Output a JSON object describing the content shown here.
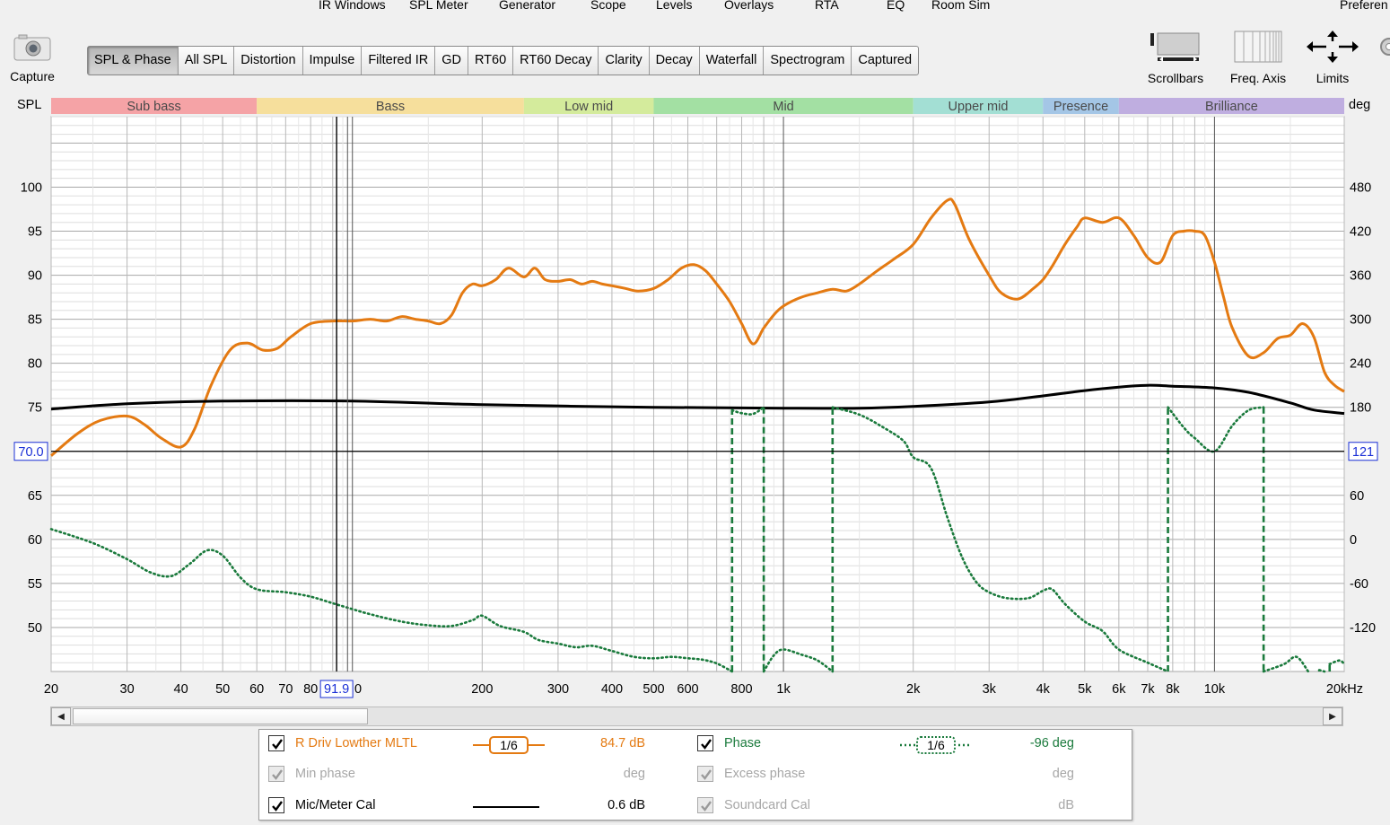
{
  "menu": [
    "IR Windows",
    "SPL Meter",
    "Generator",
    "Scope",
    "Levels",
    "Overlays",
    "RTA",
    "EQ",
    "Room Sim",
    "Preferen"
  ],
  "capture": {
    "label": "Capture"
  },
  "tabs": [
    "SPL & Phase",
    "All SPL",
    "Distortion",
    "Impulse",
    "Filtered IR",
    "GD",
    "RT60",
    "RT60 Decay",
    "Clarity",
    "Decay",
    "Waterfall",
    "Spectrogram",
    "Captured"
  ],
  "active_tab": "SPL & Phase",
  "toolbar_right": {
    "scrollbars": "Scrollbars",
    "freq_axis": "Freq. Axis",
    "limits": "Limits",
    "co": "Co"
  },
  "legend": {
    "rows": [
      {
        "name": "R Driv Lowther MLTL",
        "checked": true,
        "color": "#e47a12",
        "smoothing": "1/6",
        "value": "84.7 dB"
      },
      {
        "name": "Phase",
        "checked": true,
        "color": "#1a7a3c",
        "smoothing": "1/6",
        "value": "-96 deg"
      },
      {
        "name": "Min phase",
        "checked": true,
        "disabled": true,
        "value": "deg"
      },
      {
        "name": "Excess phase",
        "checked": true,
        "disabled": true,
        "value": "deg"
      },
      {
        "name": "Mic/Meter Cal",
        "checked": true,
        "color": "#000000",
        "value": "0.6 dB"
      },
      {
        "name": "Soundcard Cal",
        "checked": true,
        "disabled": true,
        "value": "dB"
      }
    ]
  },
  "chart_data": {
    "type": "line",
    "x_scale": "log",
    "xlim": [
      20,
      20000
    ],
    "ylim": [
      45,
      108
    ],
    "y2lim": [
      -180,
      576
    ],
    "ylabel": "SPL",
    "y2label": "deg",
    "grid": true,
    "y_ticks": [
      100,
      95,
      90,
      85,
      80,
      75,
      70.0,
      65,
      60,
      55,
      50
    ],
    "y2_ticks": [
      480,
      420,
      360,
      300,
      240,
      180,
      121,
      60,
      0,
      -60,
      -120
    ],
    "x_ticks": [
      "20",
      "30",
      "40",
      "50",
      "60",
      "70",
      "80",
      "91.9",
      "0",
      "200",
      "300",
      "400",
      "500",
      "600",
      "800",
      "1k",
      "2k",
      "3k",
      "4k",
      "5k",
      "6k",
      "7k",
      "8k",
      "10k",
      "20kHz"
    ],
    "x_tick_values": [
      20,
      30,
      40,
      50,
      60,
      70,
      80,
      91.9,
      100,
      200,
      300,
      400,
      500,
      600,
      800,
      1000,
      2000,
      3000,
      4000,
      5000,
      6000,
      7000,
      8000,
      10000,
      20000
    ],
    "cursor": {
      "x": 91.9,
      "x_label": "91.9",
      "y": 70.0,
      "y_label": "70.0",
      "y2_label": "121"
    },
    "bands": [
      {
        "name": "Sub bass",
        "from": 20,
        "to": 60,
        "color": "#f5a3a6"
      },
      {
        "name": "Bass",
        "from": 60,
        "to": 250,
        "color": "#f6df9c"
      },
      {
        "name": "Low mid",
        "from": 250,
        "to": 500,
        "color": "#d4eb9c"
      },
      {
        "name": "Mid",
        "from": 500,
        "to": 2000,
        "color": "#a3e0a3"
      },
      {
        "name": "Upper mid",
        "from": 2000,
        "to": 4000,
        "color": "#a3dfd4"
      },
      {
        "name": "Presence",
        "from": 4000,
        "to": 6000,
        "color": "#a4c6e6"
      },
      {
        "name": "Brilliance",
        "from": 6000,
        "to": 20000,
        "color": "#bfaee0"
      }
    ],
    "series": [
      {
        "name": "R Driv Lowther MLTL",
        "axis": "left",
        "style": "solid",
        "color": "#e47a12",
        "x": [
          20,
          23,
          26,
          30,
          33,
          36,
          40,
          43,
          47,
          52,
          57,
          62,
          67,
          72,
          80,
          90,
          100,
          110,
          120,
          130,
          140,
          150,
          160,
          170,
          180,
          190,
          200,
          215,
          230,
          250,
          265,
          280,
          300,
          320,
          340,
          360,
          380,
          400,
          430,
          460,
          500,
          540,
          580,
          620,
          660,
          700,
          750,
          800,
          850,
          900,
          950,
          1000,
          1100,
          1200,
          1300,
          1400,
          1500,
          1650,
          1800,
          2000,
          2200,
          2400,
          2500,
          2700,
          3000,
          3200,
          3500,
          3800,
          4000,
          4200,
          4500,
          4800,
          5000,
          5500,
          6000,
          6500,
          7000,
          7500,
          8000,
          8500,
          9000,
          9500,
          10000,
          10500,
          11000,
          12000,
          13000,
          14000,
          15000,
          16000,
          17000,
          18000,
          19000,
          20000
        ],
        "y": [
          69.5,
          72,
          73.5,
          74,
          73,
          71.5,
          70.5,
          72.5,
          77.5,
          81.5,
          82.3,
          81.5,
          81.7,
          83,
          84.5,
          84.8,
          84.8,
          85,
          84.8,
          85.3,
          85,
          84.8,
          84.5,
          85.5,
          88,
          89,
          88.8,
          89.5,
          90.8,
          89.8,
          90.8,
          89.5,
          89.3,
          89.5,
          89,
          89.3,
          89,
          88.8,
          88.5,
          88.2,
          88.5,
          89.5,
          90.8,
          91.2,
          90.5,
          89,
          87,
          84.5,
          82.2,
          84,
          85.5,
          86.5,
          87.5,
          88,
          88.4,
          88.2,
          89,
          90.5,
          91.8,
          93.5,
          96.5,
          98.5,
          98,
          94,
          90,
          88,
          87.3,
          88.5,
          89.5,
          91,
          93.5,
          95.5,
          96.5,
          96,
          96.5,
          94.5,
          92,
          91.5,
          94.5,
          95,
          95,
          94.5,
          91.5,
          87.5,
          84,
          80.8,
          81.2,
          82.8,
          83.2,
          84.5,
          83,
          79,
          77.5,
          76.8
        ]
      },
      {
        "name": "Mic/Meter Cal",
        "axis": "left",
        "style": "solid",
        "color": "#000000",
        "x": [
          20,
          30,
          50,
          100,
          200,
          500,
          1000,
          1500,
          2000,
          3000,
          4000,
          5000,
          6000,
          7000,
          8000,
          10000,
          12000,
          15000,
          17000,
          20000
        ],
        "y": [
          74.8,
          75.4,
          75.7,
          75.7,
          75.3,
          75.0,
          74.9,
          74.9,
          75.1,
          75.6,
          76.3,
          76.9,
          77.3,
          77.5,
          77.4,
          77.2,
          76.7,
          75.5,
          74.7,
          74.3
        ]
      },
      {
        "name": "Phase",
        "axis": "right",
        "style": "dotted",
        "color": "#1a7a3c",
        "segments": [
          {
            "x": [
              20,
              25,
              30,
              34,
              38,
              42,
              46,
              50,
              55,
              60,
              70,
              80,
              90,
              100,
              110,
              130,
              150,
              170,
              190,
              200,
              220,
              250,
              270,
              300,
              330,
              360,
              400,
              450,
              500,
              550,
              600,
              650,
              700,
              760
            ],
            "y": [
              14,
              -5,
              -27,
              -45,
              -50,
              -33,
              -15,
              -22,
              -52,
              -68,
              -72,
              -78,
              -87,
              -95,
              -102,
              -112,
              -117,
              -118,
              -110,
              -104,
              -118,
              -126,
              -137,
              -142,
              -147,
              -145,
              -152,
              -160,
              -162,
              -160,
              -162,
              -164,
              -169,
              -180
            ]
          },
          {
            "x": [
              760,
              800,
              850,
              900
            ],
            "y": [
              176,
              172,
              171,
              180
            ]
          },
          {
            "x": [
              900,
              950,
              1000,
              1100,
              1200,
              1300
            ],
            "y": [
              -180,
              -158,
              -150,
              -157,
              -165,
              -180
            ]
          },
          {
            "x": [
              1300,
              1500,
              1700,
              1900,
              2000,
              2200,
              2400,
              2600,
              2800,
              3000,
              3300,
              3700,
              4000,
              4200,
              4500,
              5000,
              5500,
              6000,
              7000,
              7800
            ],
            "y": [
              180,
              170,
              153,
              134,
              112,
              97,
              30,
              -25,
              -58,
              -72,
              -80,
              -80,
              -70,
              -68,
              -88,
              -112,
              -125,
              -150,
              -168,
              -180
            ]
          },
          {
            "x": [
              7800,
              8500,
              9000,
              10000,
              11000,
              12000,
              13000
            ],
            "y": [
              180,
              152,
              138,
              120,
              155,
              176,
              180
            ]
          },
          {
            "x": [
              13000,
              14500,
              15500,
              16500
            ],
            "y": [
              -180,
              -170,
              -160,
              -180
            ]
          },
          {
            "x": [
              17500,
              18000
            ],
            "y": [
              -178,
              -180
            ]
          },
          {
            "x": [
              18500,
              19500,
              20000
            ],
            "y": [
              -170,
              -165,
              -170
            ]
          }
        ]
      }
    ]
  }
}
